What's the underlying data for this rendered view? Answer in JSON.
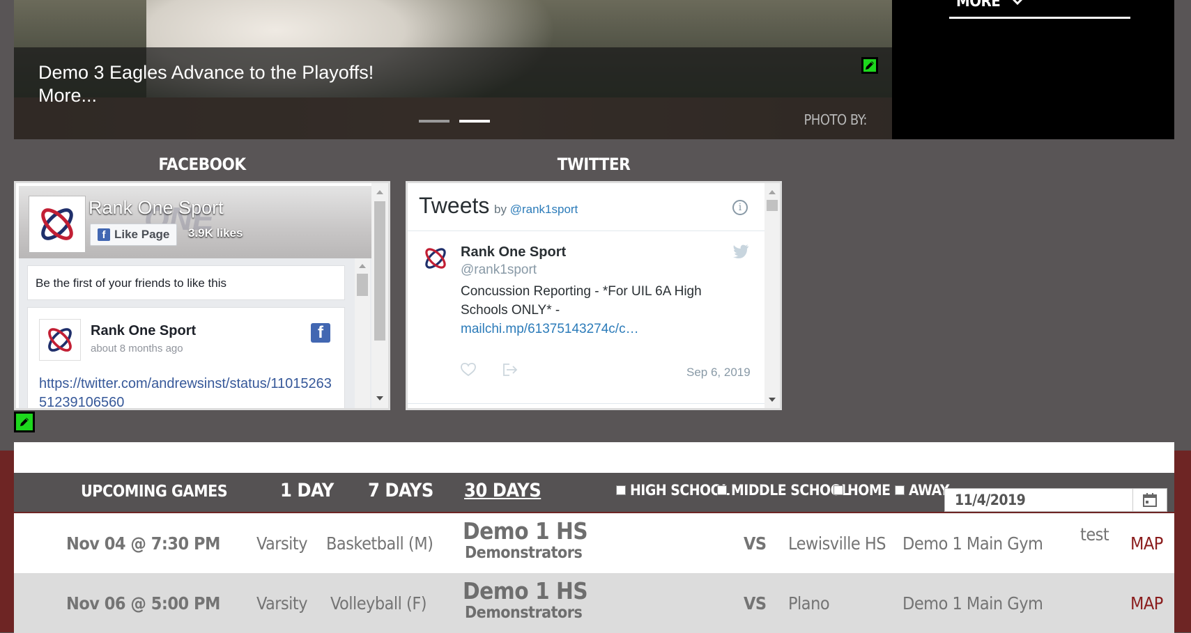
{
  "hero": {
    "headline": "Demo 3 Eagles Advance to the Playoffs!",
    "more_link": "More...",
    "photo_credit": "PHOTO BY:",
    "slide_count": 2,
    "active_slide": 2
  },
  "top_nav": {
    "more_label": "MORE"
  },
  "social": {
    "facebook_title": "FACEBOOK",
    "twitter_title": "TWITTER",
    "facebook": {
      "page_name": "Rank One Sport",
      "like_button": "Like Page",
      "likes": "3.9K likes",
      "friends_text": "Be the first of your friends to like this",
      "post": {
        "author": "Rank One Sport",
        "time": "about 8 months ago",
        "link": "https://twitter.com/andrewsinst/status/1101526351239106560"
      }
    },
    "twitter": {
      "header": "Tweets",
      "by_label": "by",
      "handle": "@rank1sport",
      "tweet": {
        "name": "Rank One Sport",
        "handle": "@rank1sport",
        "text": "Concussion Reporting - *For UIL 6A High Schools ONLY* - ",
        "link": "mailchi.mp/61375143274c/c…",
        "date": "Sep 6, 2019"
      }
    }
  },
  "games": {
    "label": "UPCOMING GAMES",
    "tabs": [
      "1 DAY",
      "7 DAYS",
      "30 DAYS"
    ],
    "active_tab": "30 DAYS",
    "filters": [
      "HIGH SCHOOL",
      "MIDDLE SCHOOL",
      "HOME",
      "AWAY"
    ],
    "date_value": "11/4/2019",
    "rows": [
      {
        "datetime": "Nov 04 @ 7:30 PM",
        "level": "Varsity",
        "sport": "Basketball (M)",
        "home": "Demo 1 HS",
        "home_team": "Demonstrators",
        "vs": "VS",
        "opponent": "Lewisville HS",
        "location": "Demo 1 Main Gym",
        "note": "test",
        "map": "MAP"
      },
      {
        "datetime": "Nov 06 @ 5:00 PM",
        "level": "Varsity",
        "sport": "Volleyball (F)",
        "home": "Demo 1 HS",
        "home_team": "Demonstrators",
        "vs": "VS",
        "opponent": "Plano",
        "location": "Demo 1 Main Gym",
        "note": "",
        "map": "MAP"
      }
    ]
  },
  "colors": {
    "page_bg": "#595556",
    "maroon": "#6e2524",
    "edit_green": "#1dd81d",
    "link_blue": "#2b7bb9"
  }
}
